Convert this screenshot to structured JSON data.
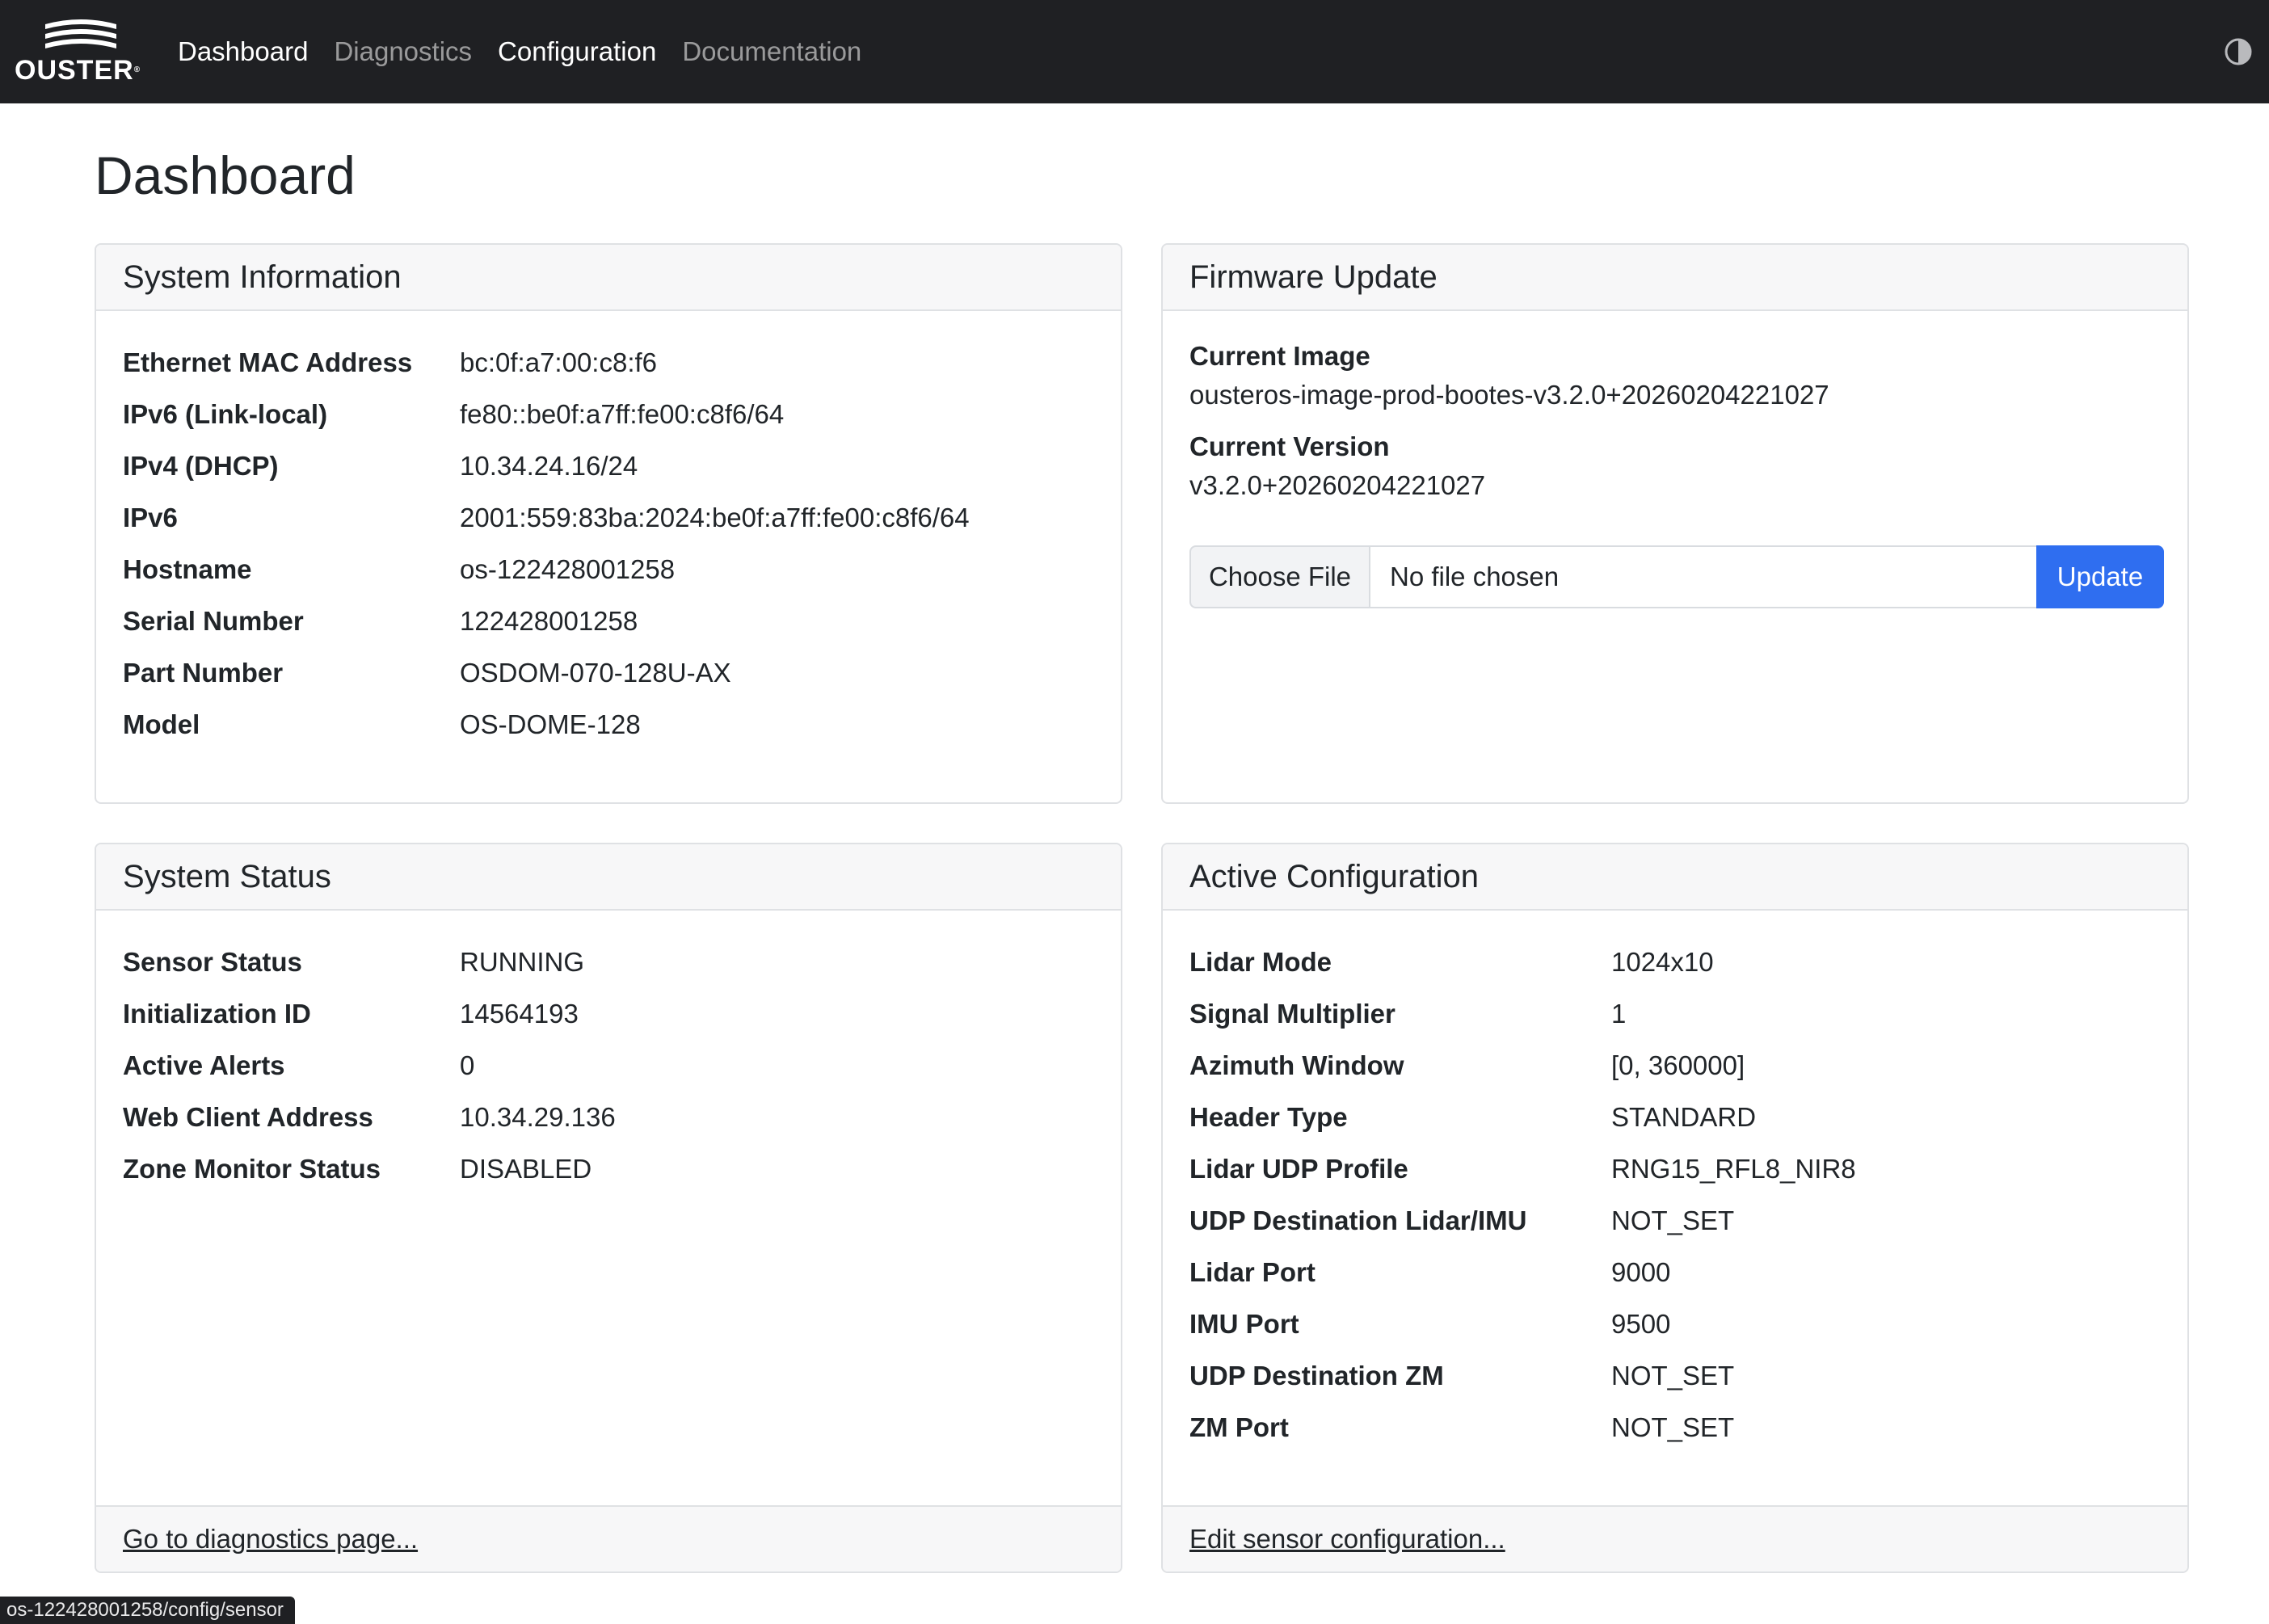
{
  "brand": {
    "name": "OUSTER",
    "trademark": "®"
  },
  "nav": {
    "items": [
      {
        "label": "Dashboard",
        "state": "active"
      },
      {
        "label": "Diagnostics",
        "state": "muted"
      },
      {
        "label": "Configuration",
        "state": "bright"
      },
      {
        "label": "Documentation",
        "state": "muted"
      }
    ],
    "theme_toggle_icon": "contrast-half-circle-icon"
  },
  "page": {
    "title": "Dashboard"
  },
  "system_information": {
    "title": "System Information",
    "rows": [
      {
        "label": "Ethernet MAC Address",
        "value": "bc:0f:a7:00:c8:f6"
      },
      {
        "label": "IPv6 (Link-local)",
        "value": "fe80::be0f:a7ff:fe00:c8f6/64"
      },
      {
        "label": "IPv4 (DHCP)",
        "value": "10.34.24.16/24"
      },
      {
        "label": "IPv6",
        "value": "2001:559:83ba:2024:be0f:a7ff:fe00:c8f6/64"
      },
      {
        "label": "Hostname",
        "value": "os-122428001258"
      },
      {
        "label": "Serial Number",
        "value": "122428001258"
      },
      {
        "label": "Part Number",
        "value": "OSDOM-070-128U-AX"
      },
      {
        "label": "Model",
        "value": "OS-DOME-128"
      }
    ]
  },
  "firmware_update": {
    "title": "Firmware Update",
    "current_image_label": "Current Image",
    "current_image_value": "ousteros-image-prod-bootes-v3.2.0+20260204221027",
    "current_version_label": "Current Version",
    "current_version_value": "v3.2.0+20260204221027",
    "choose_file_label": "Choose File",
    "file_name": "No file chosen",
    "update_label": "Update"
  },
  "system_status": {
    "title": "System Status",
    "rows": [
      {
        "label": "Sensor Status",
        "value": "RUNNING"
      },
      {
        "label": "Initialization ID",
        "value": "14564193"
      },
      {
        "label": "Active Alerts",
        "value": "0"
      },
      {
        "label": "Web Client Address",
        "value": "10.34.29.136"
      },
      {
        "label": "Zone Monitor Status",
        "value": "DISABLED"
      }
    ],
    "footer_link": "Go to diagnostics page..."
  },
  "active_configuration": {
    "title": "Active Configuration",
    "rows": [
      {
        "label": "Lidar Mode",
        "value": "1024x10"
      },
      {
        "label": "Signal Multiplier",
        "value": "1"
      },
      {
        "label": "Azimuth Window",
        "value": "[0, 360000]"
      },
      {
        "label": "Header Type",
        "value": "STANDARD"
      },
      {
        "label": "Lidar UDP Profile",
        "value": "RNG15_RFL8_NIR8"
      },
      {
        "label": "UDP Destination Lidar/IMU",
        "value": "NOT_SET"
      },
      {
        "label": "Lidar Port",
        "value": "9000"
      },
      {
        "label": "IMU Port",
        "value": "9500"
      },
      {
        "label": "UDP Destination ZM",
        "value": "NOT_SET"
      },
      {
        "label": "ZM Port",
        "value": "NOT_SET"
      }
    ],
    "footer_link": "Edit sensor configuration..."
  },
  "status_bar": {
    "url": "os-122428001258/config/sensor"
  },
  "colors": {
    "navbar_bg": "#1f2023",
    "primary_button": "#2f6ef0",
    "card_header_bg": "#f7f7f8",
    "border": "#dfe1e4"
  }
}
